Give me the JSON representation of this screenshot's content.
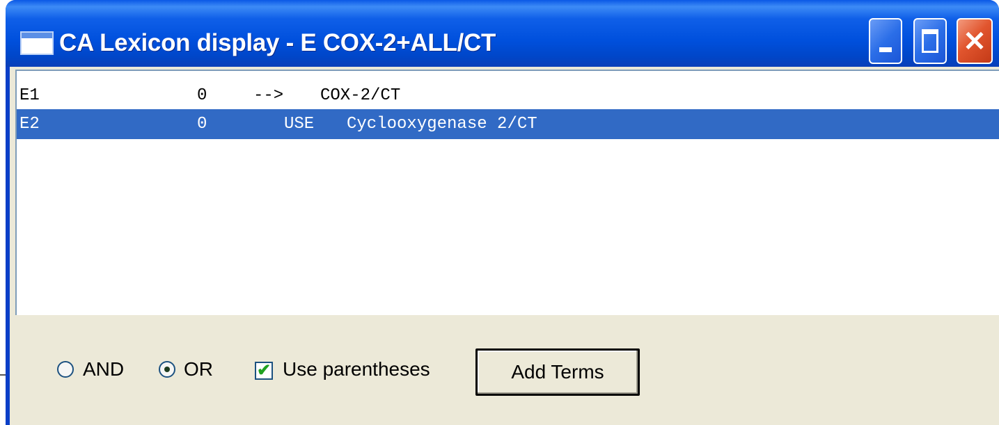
{
  "window": {
    "title": "CA Lexicon display - E COX-2+ALL/CT",
    "close_glyph": "✕"
  },
  "list": {
    "rows": [
      {
        "id": "E1",
        "count": "0",
        "rel": "-->",
        "term": "COX-2/CT",
        "selected": false
      },
      {
        "id": "E2",
        "count": "0",
        "rel": "USE",
        "term": "Cyclooxygenase 2/CT",
        "selected": true
      }
    ]
  },
  "options": {
    "and_label": "AND",
    "or_label": "OR",
    "selected_operator": "OR",
    "use_parentheses_label": "Use parentheses",
    "use_parentheses_checked": true,
    "check_glyph": "✔"
  },
  "buttons": {
    "add_terms_label": "Add Terms"
  },
  "colors": {
    "titlebar": "#0050dd",
    "selection": "#316ac5",
    "dialog_face": "#ece9d8",
    "close_button": "#e1552e"
  }
}
